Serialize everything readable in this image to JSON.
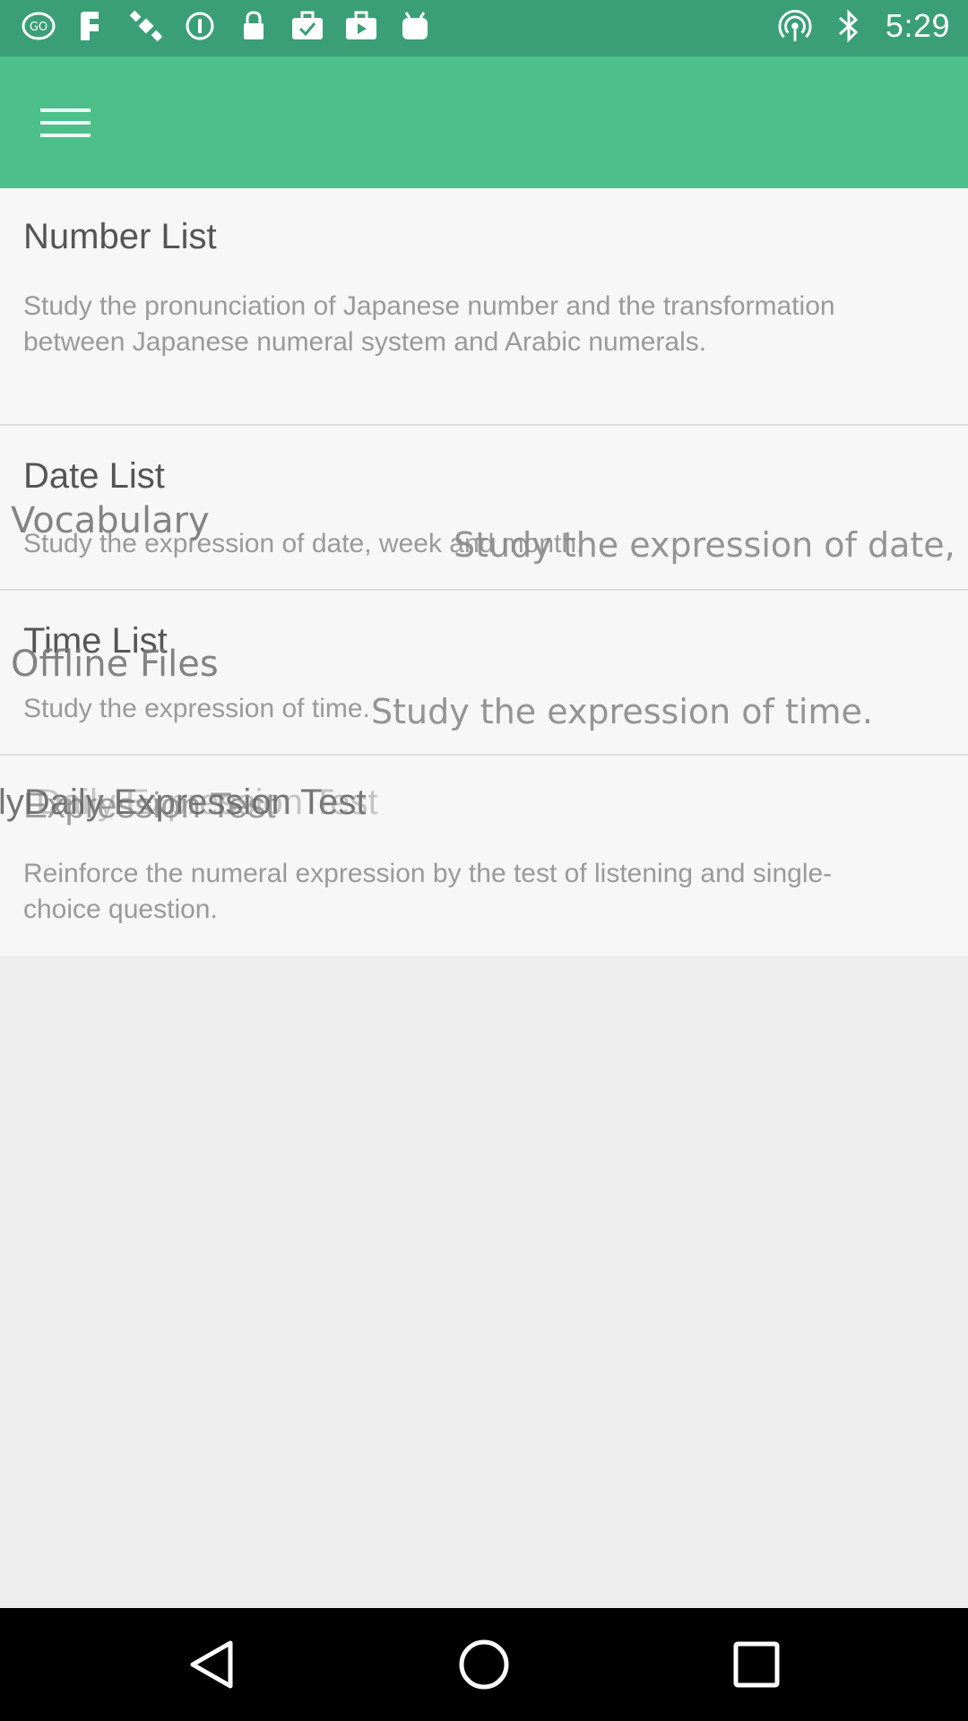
{
  "status_bar": {
    "time": "5:29",
    "left_icons": [
      "go-icon",
      "fake-icon",
      "satellite-icon",
      "info-icon",
      "lock-icon",
      "briefcase-check-icon",
      "briefcase-play-icon",
      "android-icon"
    ],
    "right_icons": [
      "hotspot-icon",
      "bluetooth-icon"
    ]
  },
  "toolbar": {
    "color": "#4dbf8b",
    "menu_icon": "hamburger-menu-icon"
  },
  "list": {
    "items": [
      {
        "title": "Number List",
        "description": "Study the pronunciation of Japanese number and the transformation between Japanese numeral system and Arabic numerals."
      },
      {
        "title": "Date List",
        "description": "Study the expression of date, week and month."
      },
      {
        "title": "Time List",
        "description": "Study the expression of time."
      },
      {
        "title": "Expression Test",
        "description": "Reinforce the numeral expression by the test of listening and single-choice question."
      }
    ]
  },
  "overlay": {
    "vocabulary_label": "Vocabulary",
    "vocabulary_desc": "Study the expression of date,",
    "offline_label": "Offline Files",
    "offline_desc": "Study the expression of time.",
    "daily_label": "lyDaily Expression Test",
    "daily_label_ghost": "Daily Expression Test"
  },
  "nav_bar": {
    "back_icon": "back-triangle-icon",
    "home_icon": "home-circle-icon",
    "recents_icon": "recents-square-icon"
  }
}
